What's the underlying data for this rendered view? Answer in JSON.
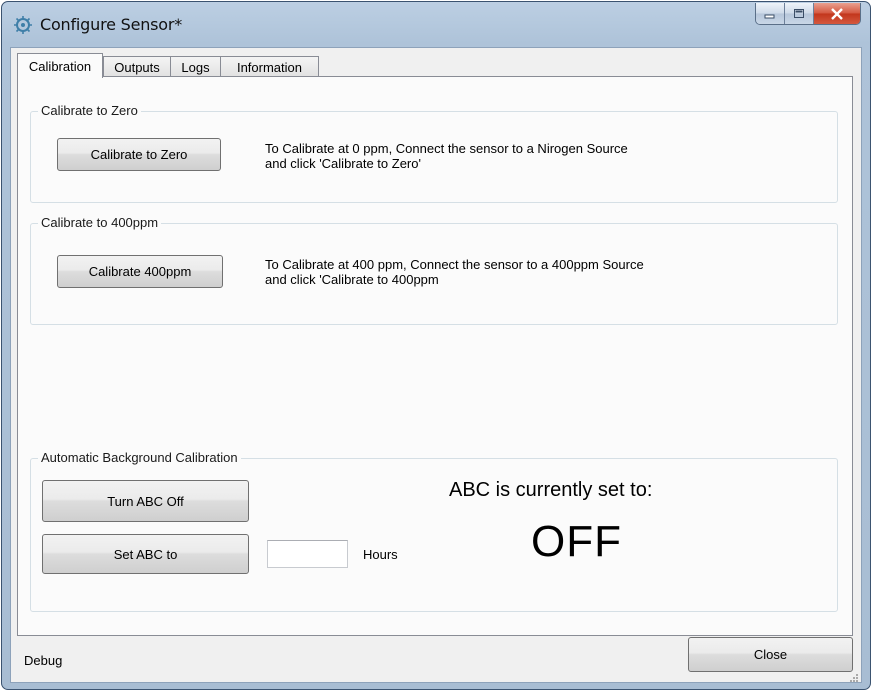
{
  "window": {
    "title": "Configure Sensor*"
  },
  "tabs": [
    {
      "label": "Calibration"
    },
    {
      "label": "Outputs"
    },
    {
      "label": "Logs"
    },
    {
      "label": "Information"
    }
  ],
  "zero": {
    "group_label": "Calibrate to Zero",
    "button": "Calibrate to Zero",
    "hint_line1": "To Calibrate at 0 ppm, Connect the sensor to a Nirogen Source",
    "hint_line2": "and click 'Calibrate to Zero'"
  },
  "ppm400": {
    "group_label": "Calibrate to 400ppm",
    "button": "Calibrate 400ppm",
    "hint_line1": "To Calibrate at 400 ppm, Connect the sensor to a 400ppm Source",
    "hint_line2": "and click 'Calibrate to 400ppm"
  },
  "abc": {
    "group_label": "Automatic Background Calibration",
    "turn_off_button": "Turn ABC Off",
    "set_button": "Set ABC to",
    "hours_value": "",
    "hours_label": "Hours",
    "status_label": "ABC is currently set to:",
    "status_value": "OFF"
  },
  "footer": {
    "debug_label": "Debug",
    "close_button": "Close"
  },
  "icons": {
    "app": "sensor-gear-icon",
    "minimize": "minimize-icon",
    "maximize": "maximize-icon",
    "close": "close-icon"
  }
}
